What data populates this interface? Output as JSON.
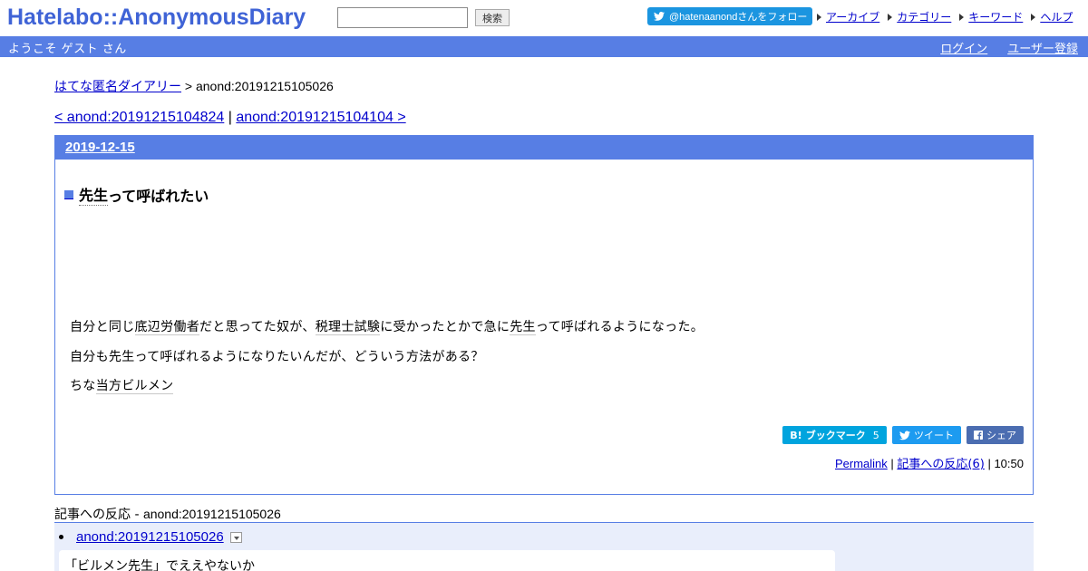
{
  "header": {
    "logo": "Hatelabo::AnonymousDiary",
    "search": {
      "value": "",
      "placeholder": "",
      "button_label": "検索"
    },
    "follow_button": "@hatenaanondさんをフォロー",
    "links": [
      "アーカイブ",
      "カテゴリー",
      "キーワード",
      "ヘルプ"
    ]
  },
  "navbar": {
    "welcome": "ようこそ ゲスト さん",
    "login": "ログイン",
    "register": "ユーザー登録"
  },
  "breadcrumb": {
    "home": "はてな匿名ダイアリー",
    "separator": " > ",
    "current": "anond:20191215105026"
  },
  "pager": {
    "prev": "< anond:20191215104824",
    "separator": " | ",
    "next": "anond:20191215104104 >"
  },
  "entry": {
    "date": "2019-12-15",
    "title_keyword": "先生",
    "title_rest": "って呼ばれたい",
    "body": [
      {
        "parts": [
          {
            "text": "自分と同じ",
            "kw": false
          },
          {
            "text": "底辺労働者",
            "kw": true
          },
          {
            "text": "だと思ってた奴が、",
            "kw": false
          },
          {
            "text": "税理士試験",
            "kw": true
          },
          {
            "text": "に受かったとかで急に",
            "kw": false
          },
          {
            "text": "先生",
            "kw": true
          },
          {
            "text": "って呼ばれるようになった。",
            "kw": false
          }
        ]
      },
      {
        "parts": [
          {
            "text": "自分も",
            "kw": false
          },
          {
            "text": "先生",
            "kw": true
          },
          {
            "text": "って呼ばれるようになりたいんだが、どういう",
            "kw": false
          },
          {
            "text": "方法",
            "kw": true
          },
          {
            "text": "がある？",
            "kw": false
          }
        ]
      },
      {
        "parts": [
          {
            "text": "ちな",
            "kw": false
          },
          {
            "text": "当方",
            "kw": true
          },
          {
            "text": "ビルメン",
            "kw": true
          }
        ]
      }
    ],
    "share": {
      "bookmark_label": "ブックマーク",
      "bookmark_count": "5",
      "tweet_label": "ツイート",
      "share_label": "シェア"
    },
    "footer": {
      "permalink": "Permalink",
      "reactions": "記事への反応(6)",
      "time": "10:50"
    }
  },
  "reactions": {
    "heading_label": "記事への反応 - ",
    "heading_id": "anond:20191215105026",
    "items": [
      {
        "link": "anond:20191215105026",
        "text": "「ビルメン先生」でええやないか"
      }
    ]
  },
  "colors": {
    "brand": "#577ee4",
    "logo": "#3f63d6",
    "link": "#0000cc",
    "twitter": "#1d9bf0",
    "hatena_bookmark": "#00a4de",
    "facebook": "#4b6db1"
  }
}
